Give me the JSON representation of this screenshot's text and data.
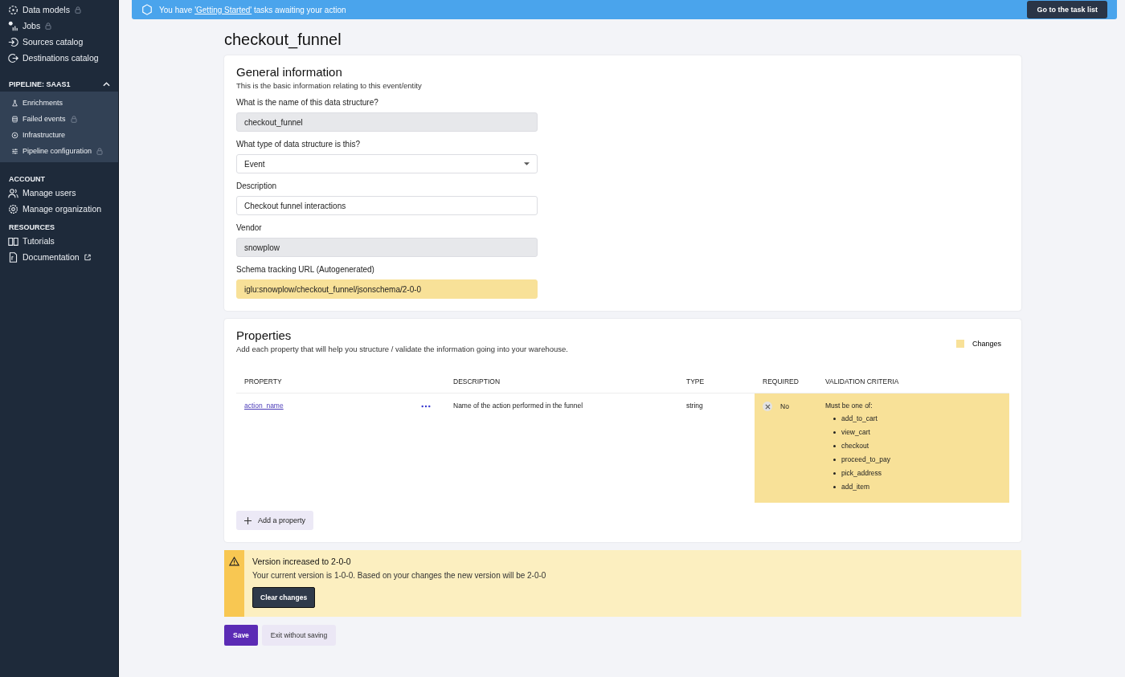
{
  "sidebar": {
    "top_items": [
      {
        "label": "Data models",
        "locked": true
      },
      {
        "label": "Jobs",
        "locked": true
      },
      {
        "label": "Sources catalog",
        "locked": false
      },
      {
        "label": "Destinations catalog",
        "locked": false
      }
    ],
    "pipeline": {
      "title": "PIPELINE: SAAS1",
      "expanded": true,
      "items": [
        {
          "label": "Enrichments",
          "locked": false
        },
        {
          "label": "Failed events",
          "locked": true
        },
        {
          "label": "Infrastructure",
          "locked": false
        },
        {
          "label": "Pipeline configuration",
          "locked": true
        }
      ]
    },
    "sections": [
      {
        "title": "ACCOUNT",
        "items": [
          {
            "label": "Manage users",
            "external": false
          },
          {
            "label": "Manage organization",
            "external": false
          }
        ]
      },
      {
        "title": "RESOURCES",
        "items": [
          {
            "label": "Tutorials",
            "external": false
          },
          {
            "label": "Documentation",
            "external": true
          }
        ]
      }
    ]
  },
  "banner": {
    "before": "You have ",
    "link": "'Getting Started'",
    "after": " tasks awaiting your action",
    "button": "Go to the task list"
  },
  "title": "checkout_funnel",
  "general": {
    "title": "General information",
    "subtitle": "This is the basic information relating to this event/entity",
    "fields": [
      {
        "label": "What is the name of this data structure?",
        "value": "checkout_funnel",
        "kind": "readonly"
      },
      {
        "label": "What type of data structure is this?",
        "value": "Event",
        "kind": "select"
      },
      {
        "label": "Description",
        "value": "Checkout funnel interactions",
        "kind": "text"
      },
      {
        "label": "Vendor",
        "value": "snowplow",
        "kind": "readonly"
      },
      {
        "label": "Schema tracking URL (Autogenerated)",
        "value": "iglu:snowplow/checkout_funnel/jsonschema/2-0-0",
        "kind": "changed"
      }
    ]
  },
  "properties": {
    "title": "Properties",
    "subtitle": "Add each property that will help you structure / validate the information going into your warehouse.",
    "legend": "Changes",
    "columns": [
      "PROPERTY",
      "DESCRIPTION",
      "TYPE",
      "REQUIRED",
      "VALIDATION CRITERIA"
    ],
    "rows": [
      {
        "name": "action_name",
        "description": "Name of the action performed in the funnel",
        "type": "string",
        "required": false,
        "required_label": "No",
        "changed": true,
        "criteria_title": "Must be one of:",
        "criteria": [
          "add_to_cart",
          "view_cart",
          "checkout",
          "proceed_to_pay",
          "pick_address",
          "add_item"
        ]
      }
    ],
    "add_button": "Add a property"
  },
  "warning": {
    "title": "Version increased to 2-0-0",
    "text": "Your current version is 1-0-0. Based on your changes the new version will be 2-0-0",
    "button": "Clear changes"
  },
  "actions": {
    "save": "Save",
    "exit": "Exit without saving"
  }
}
